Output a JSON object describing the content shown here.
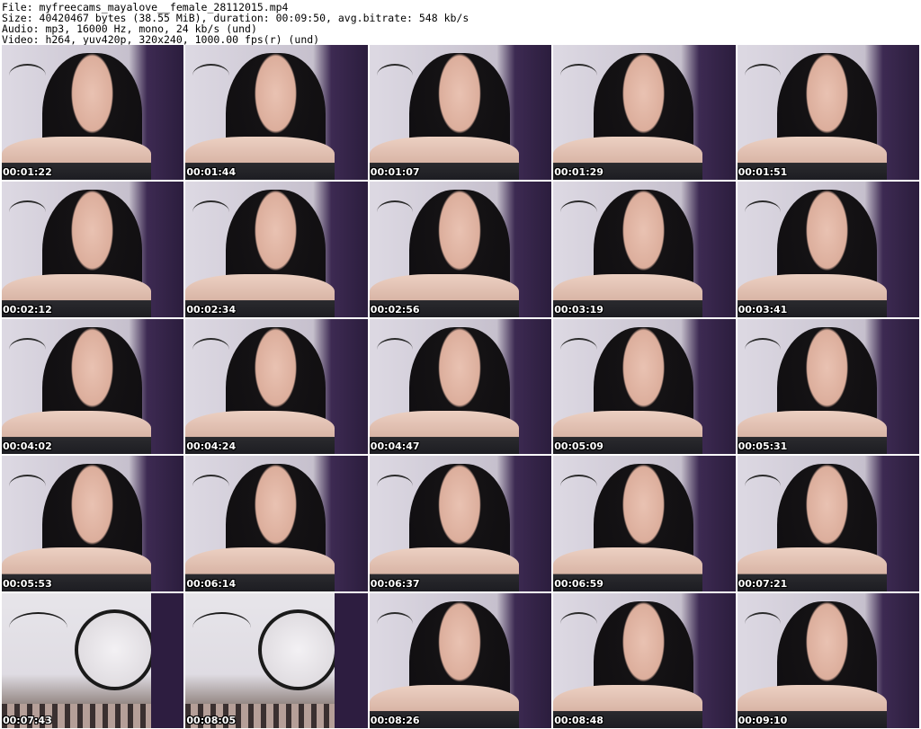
{
  "header": {
    "file": "File: myfreecams_mayalove__female_28112015.mp4",
    "size": "Size: 40420467 bytes (38.55 MiB), duration: 00:09:50, avg.bitrate: 548 kb/s",
    "audio": "Audio: mp3, 16000 Hz, mono, 24 kb/s (und)",
    "video": "Video: h264, yuv420p, 320x240, 1000.00 fps(r) (und)"
  },
  "thumbnails": [
    {
      "ts": "00:01:22",
      "scene": "person"
    },
    {
      "ts": "00:01:44",
      "scene": "person"
    },
    {
      "ts": "00:01:07",
      "scene": "person"
    },
    {
      "ts": "00:01:29",
      "scene": "person"
    },
    {
      "ts": "00:01:51",
      "scene": "person"
    },
    {
      "ts": "00:02:12",
      "scene": "person"
    },
    {
      "ts": "00:02:34",
      "scene": "person"
    },
    {
      "ts": "00:02:56",
      "scene": "person"
    },
    {
      "ts": "00:03:19",
      "scene": "person"
    },
    {
      "ts": "00:03:41",
      "scene": "person"
    },
    {
      "ts": "00:04:02",
      "scene": "person"
    },
    {
      "ts": "00:04:24",
      "scene": "person"
    },
    {
      "ts": "00:04:47",
      "scene": "person"
    },
    {
      "ts": "00:05:09",
      "scene": "person"
    },
    {
      "ts": "00:05:31",
      "scene": "person"
    },
    {
      "ts": "00:05:53",
      "scene": "person"
    },
    {
      "ts": "00:06:14",
      "scene": "person"
    },
    {
      "ts": "00:06:37",
      "scene": "person"
    },
    {
      "ts": "00:06:59",
      "scene": "person"
    },
    {
      "ts": "00:07:21",
      "scene": "person"
    },
    {
      "ts": "00:07:43",
      "scene": "room"
    },
    {
      "ts": "00:08:05",
      "scene": "room"
    },
    {
      "ts": "00:08:26",
      "scene": "person"
    },
    {
      "ts": "00:08:48",
      "scene": "person"
    },
    {
      "ts": "00:09:10",
      "scene": "person"
    }
  ]
}
